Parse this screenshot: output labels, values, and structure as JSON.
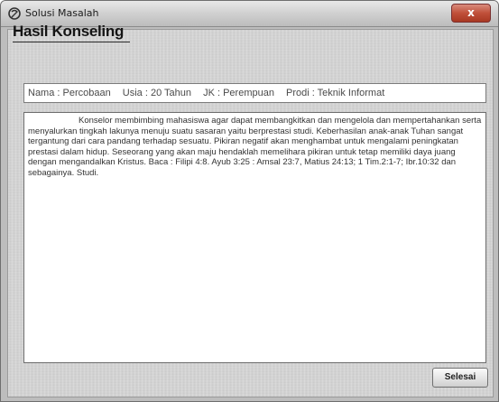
{
  "window": {
    "title": "Solusi Masalah",
    "close_label": "x"
  },
  "main": {
    "heading": "Hasil Konseling",
    "info": {
      "nama": "Nama : Percobaan",
      "usia": "Usia : 20 Tahun",
      "jk": "JK : Perempuan",
      "prodi": "Prodi : Teknik Informat"
    },
    "result_text": "Konselor membimbing mahasiswa agar dapat membangkitkan dan mengelola dan mempertahankan serta menyalurkan tingkah lakunya menuju suatu sasaran yaitu berprestasi studi. Keberhasilan anak-anak Tuhan sangat tergantung dari cara pandang terhadap sesuatu. Pikiran negatif akan menghambat untuk mengalami peningkatan prestasi dalam hidup. Seseorang yang akan maju hendaklah memelihara pikiran untuk tetap memiliki daya juang dengan mengandalkan Kristus. Baca : Filipi 4:8. Ayub 3:25 : Amsal 23:7, Matius 24:13; 1 Tim.2:1-7; Ibr.10:32 dan sebagainya. Studi.",
    "finish_label": "Selesai"
  },
  "colors": {
    "window_bg": "#d7d7d7",
    "close_button": "#c0503a"
  },
  "icons": {
    "app": "app-icon"
  }
}
